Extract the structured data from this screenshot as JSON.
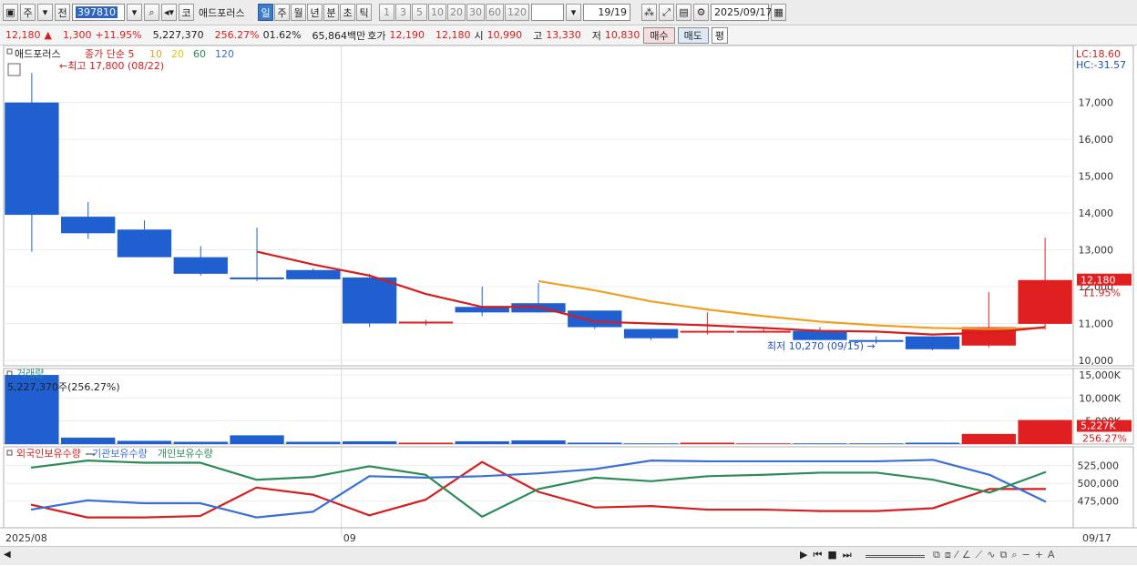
{
  "toolbar": {
    "period_label": "주",
    "prev_label": "전",
    "code_value": "397810",
    "search_icon": "search-icon",
    "stock_type_label": "코",
    "stock_name": "애드포러스",
    "period_tabs": [
      "일",
      "주",
      "월",
      "년",
      "분",
      "초",
      "틱"
    ],
    "active_period": "일",
    "interval_buttons": [
      "1",
      "3",
      "5",
      "10",
      "20",
      "30",
      "60",
      "120"
    ],
    "count_value": "19/19",
    "date_value": "2025/09/17"
  },
  "quote": {
    "price": "12,180",
    "change": "1,300",
    "change_pct": "+11.95%",
    "volume": "5,227,370",
    "volume_ratio": "256.27%",
    "turnover": "01.62%",
    "trade_amount": "65,864백만",
    "ask_label": "호가",
    "ask1": "12,190",
    "bid1": "12,180",
    "open_label": "시",
    "open": "10,990",
    "high_label": "고",
    "high": "13,330",
    "low_label": "저",
    "low": "10,830",
    "buy_label": "매수",
    "sell_label": "매도",
    "eval_label": "평"
  },
  "price_panel": {
    "stock_name": "애드포러스",
    "ma_label": "종가 단순",
    "ma_periods": [
      "5",
      "10",
      "20",
      "60",
      "120"
    ],
    "ma_colors": [
      "#d61e1e",
      "#f0a020",
      "#e6c800",
      "#2e8b57",
      "#3a6fd8"
    ],
    "high_note": "최고 17,800 (08/22)",
    "low_note": "최저 10,270 (09/15)",
    "lc": "LC:18.60",
    "hc": "HC:-31.57",
    "last_price_tag": "12,180",
    "last_pct_tag": "11.95%"
  },
  "volume_panel": {
    "title": "거래량",
    "value_note": "5,227,370주(256.27%)",
    "last_tag": "5,227K",
    "last_pct": "256.27%"
  },
  "holding_panel": {
    "series_names": [
      "외국인보유수량",
      "기관보유수량",
      "개인보유수량"
    ],
    "colors": [
      "#d61e1e",
      "#3a6fd8",
      "#2e8b57"
    ]
  },
  "x_axis": {
    "start_label": "2025/08",
    "mid_label": "09",
    "end_label": "09/17"
  },
  "chart_data": [
    {
      "type": "candlestick",
      "title": "애드포러스",
      "ylim": [
        9900,
        18400
      ],
      "y_ticks": [
        10000,
        11000,
        12000,
        13000,
        14000,
        15000,
        16000,
        17000
      ],
      "y_tick_labels": [
        "10,000",
        "11,000",
        "12,000",
        "13,000",
        "14,000",
        "15,000",
        "16,000",
        "17,000"
      ],
      "candles": [
        {
          "o": 17000,
          "h": 17800,
          "l": 12950,
          "c": 13950
        },
        {
          "o": 13900,
          "h": 14300,
          "l": 13300,
          "c": 13450
        },
        {
          "o": 13550,
          "h": 13800,
          "l": 12800,
          "c": 12800
        },
        {
          "o": 12800,
          "h": 13100,
          "l": 12300,
          "c": 12350
        },
        {
          "o": 12250,
          "h": 13600,
          "l": 12150,
          "c": 12200
        },
        {
          "o": 12450,
          "h": 12500,
          "l": 12200,
          "c": 12200
        },
        {
          "o": 12250,
          "h": 12350,
          "l": 10900,
          "c": 11000
        },
        {
          "o": 11050,
          "h": 11100,
          "l": 10950,
          "c": 11050
        },
        {
          "o": 11450,
          "h": 12000,
          "l": 11200,
          "c": 11300
        },
        {
          "o": 11550,
          "h": 12100,
          "l": 11300,
          "c": 11300
        },
        {
          "o": 11350,
          "h": 11350,
          "l": 10850,
          "c": 10900
        },
        {
          "o": 10850,
          "h": 10850,
          "l": 10550,
          "c": 10600
        },
        {
          "o": 10800,
          "h": 11300,
          "l": 10700,
          "c": 10800
        },
        {
          "o": 10800,
          "h": 10850,
          "l": 10750,
          "c": 10800
        },
        {
          "o": 10800,
          "h": 10900,
          "l": 10550,
          "c": 10550
        },
        {
          "o": 10550,
          "h": 10650,
          "l": 10450,
          "c": 10500
        },
        {
          "o": 10650,
          "h": 10650,
          "l": 10270,
          "c": 10300
        },
        {
          "o": 10400,
          "h": 11850,
          "l": 10350,
          "c": 10900
        },
        {
          "o": 10990,
          "h": 13330,
          "l": 10830,
          "c": 12180
        }
      ],
      "ma5": [
        null,
        null,
        null,
        null,
        12950,
        12600,
        12300,
        11800,
        11450,
        11450,
        11050,
        11000,
        10950,
        10880,
        10800,
        10780,
        10700,
        10750,
        10900
      ],
      "ma10": [
        null,
        null,
        null,
        null,
        null,
        null,
        null,
        null,
        null,
        12150,
        11900,
        11600,
        11380,
        11200,
        11050,
        10950,
        10880,
        10850,
        10880
      ]
    },
    {
      "type": "bar",
      "title": "거래량",
      "ylim": [
        0,
        15800000
      ],
      "y_ticks": [
        5000000,
        10000000,
        15000000
      ],
      "y_tick_labels": [
        "5,000K",
        "10,000K",
        "15,000K"
      ],
      "values": [
        15000000,
        1400000,
        700000,
        500000,
        1900000,
        500000,
        600000,
        300000,
        600000,
        800000,
        300000,
        150000,
        300000,
        150000,
        150000,
        150000,
        300000,
        2200000,
        5227370
      ]
    },
    {
      "type": "line",
      "series_names": [
        "외국인보유수량",
        "기관보유수량",
        "개인보유수량"
      ],
      "ylim": [
        440000,
        545000
      ],
      "y_ticks": [
        475000,
        500000,
        525000
      ],
      "y_tick_labels": [
        "475,000",
        "500,000",
        "525,000"
      ],
      "foreign": [
        470000,
        452000,
        452000,
        454000,
        494000,
        484000,
        455000,
        477000,
        530000,
        488000,
        466000,
        468000,
        463000,
        463000,
        461000,
        461000,
        465000,
        492000,
        492000
      ],
      "institution": [
        463000,
        476000,
        472000,
        472000,
        452000,
        460000,
        510000,
        508000,
        510000,
        514000,
        520000,
        532000,
        531000,
        531000,
        531000,
        531000,
        533000,
        512000,
        474000
      ],
      "individual": [
        522000,
        532000,
        529000,
        529000,
        505000,
        509000,
        524000,
        512000,
        453000,
        492000,
        508000,
        503000,
        510000,
        512000,
        515000,
        515000,
        505000,
        487000,
        516000
      ]
    }
  ]
}
